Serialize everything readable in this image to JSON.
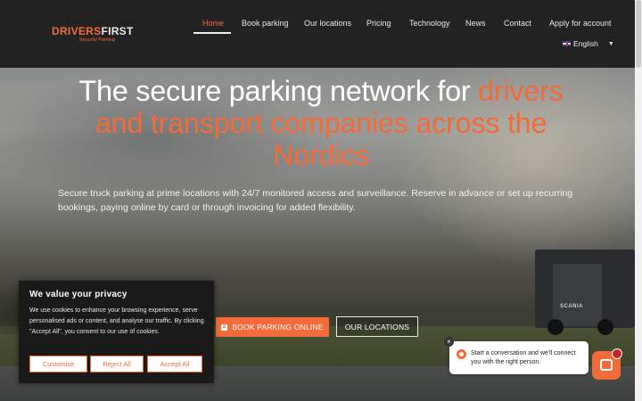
{
  "logo": {
    "main_left": "DRIVERS",
    "main_right": "FIRST",
    "sub": "Security Parking"
  },
  "nav": {
    "items": [
      {
        "label": "Home",
        "active": true
      },
      {
        "label": "Book parking"
      },
      {
        "label": "Our locations"
      },
      {
        "label": "Pricing"
      },
      {
        "label": "Technology"
      },
      {
        "label": "News"
      },
      {
        "label": "Contact"
      },
      {
        "label": "Apply for account"
      }
    ],
    "language": "English"
  },
  "hero": {
    "title_white": "The secure parking network for ",
    "title_accent": "drivers and transport companies across the Nordics",
    "description": "Secure truck parking at prime locations with 24/7 monitored access and surveillance. Reserve in advance or set up recurring bookings, paying online by card or through invoicing for added flexibility.",
    "btn_book": "BOOK PARKING ONLINE",
    "btn_locations": "OUR LOCATIONS",
    "truck_brand": "SCANIA"
  },
  "cookie": {
    "title": "We value your privacy",
    "text": "We use cookies to enhance your browsing experience, serve personalised ads or content, and analyse our traffic. By clicking \"Accept All\", you consent to our use of cookies.",
    "customise": "Customise",
    "reject": "Reject All",
    "accept": "Accept All"
  },
  "chat": {
    "message": "Start a conversation and we'll connect you with the right person.",
    "close": "×"
  },
  "colors": {
    "accent": "#f26b3a",
    "header_bg": "#222222",
    "cookie_bg": "#1a1a1a"
  }
}
